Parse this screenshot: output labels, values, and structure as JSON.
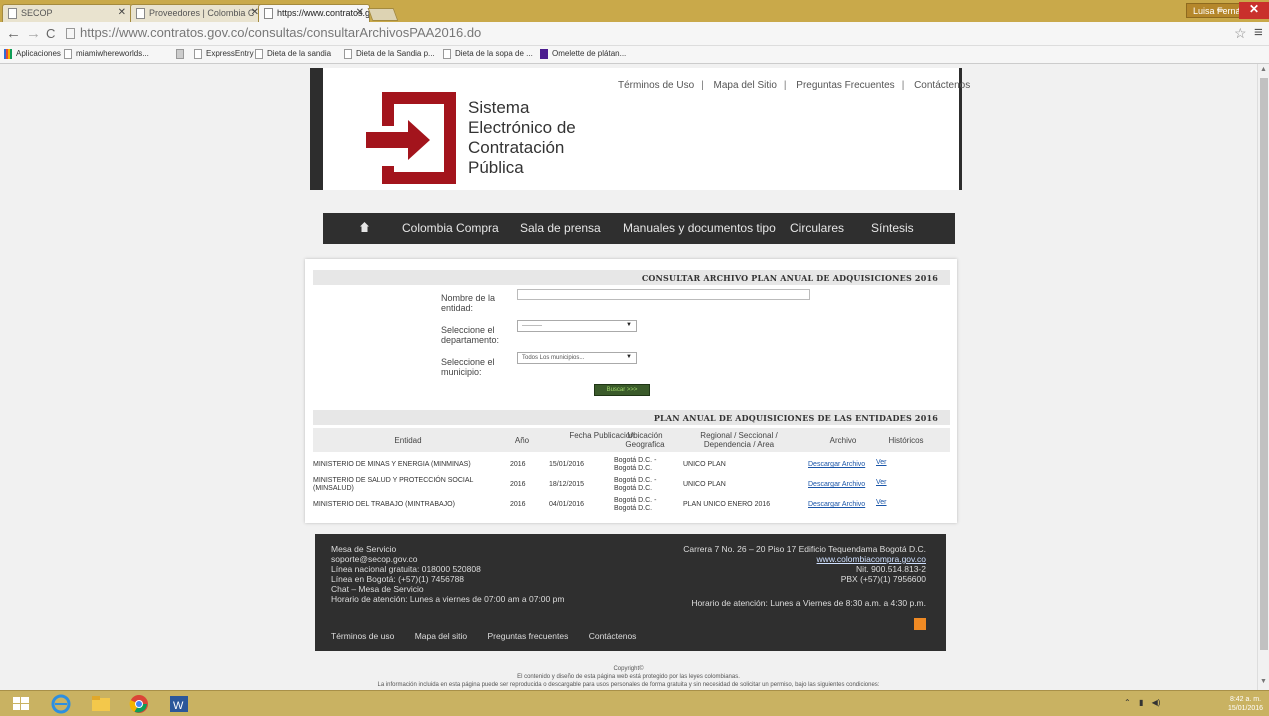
{
  "browser": {
    "tabs": [
      {
        "title": "SECOP"
      },
      {
        "title": "Proveedores | Colombia C"
      },
      {
        "title": "https://www.contratos.go"
      }
    ],
    "user": "Luisa Fernanda",
    "url": "https://www.contratos.gov.co/consultas/consultarArchivosPAA2016.do",
    "bookmarks": [
      "Aplicaciones",
      "miamiwhereworlds...",
      "",
      "ExpressEntry",
      "Dieta de la sandia",
      "Dieta de la Sandia p...",
      "Dieta de la sopa de ...",
      "Omelette de plátan..."
    ]
  },
  "header": {
    "logo_text": [
      "Sistema",
      "Electrónico de",
      "Contratación",
      "Pública"
    ],
    "links": [
      "Términos de Uso",
      "Mapa del Sitio",
      "Preguntas Frecuentes",
      "Contáctenos"
    ]
  },
  "nav": {
    "items": [
      "Colombia Compra",
      "Sala de prensa",
      "Manuales y documentos tipo",
      "Circulares",
      "Síntesis"
    ]
  },
  "form": {
    "section_title": "CONSULTAR ARCHIVO PLAN ANUAL DE ADQUISICIONES 2016",
    "entity_label": "Nombre de la entidad:",
    "entity_value": "",
    "department_label": "Seleccione el departamento:",
    "department_value": "----------",
    "municipality_label": "Seleccione el municipio:",
    "municipality_value": "Todos Los municipios...",
    "search_label": "Buscar >>>"
  },
  "results": {
    "section_title": "PLAN ANUAL DE ADQUISICIONES DE LAS ENTIDADES 2016",
    "columns": [
      "Entidad",
      "Año",
      "Fecha Publicación",
      "Ubicación Geografica",
      "Regional / Seccional / Dependencia / Area",
      "Archivo",
      "Históricos"
    ],
    "rows": [
      {
        "entidad": "MINISTERIO DE MINAS Y ENERGIA (MINMINAS)",
        "anio": "2016",
        "fecha": "15/01/2016",
        "ubicacion": "Bogotá D.C. - Bogotá D.C.",
        "regional": "UNICO PLAN",
        "archivo": "Descargar Archivo",
        "historicos": "Ver"
      },
      {
        "entidad": "MINISTERIO DE SALUD Y PROTECCIÓN SOCIAL (MINSALUD)",
        "anio": "2016",
        "fecha": "18/12/2015",
        "ubicacion": "Bogotá D.C. - Bogotá D.C.",
        "regional": "UNICO PLAN",
        "archivo": "Descargar Archivo",
        "historicos": "Ver"
      },
      {
        "entidad": "MINISTERIO DEL TRABAJO (MINTRABAJO)",
        "anio": "2016",
        "fecha": "04/01/2016",
        "ubicacion": "Bogotá D.C. - Bogotá D.C.",
        "regional": "PLAN UNICO ENERO 2016",
        "archivo": "Descargar Archivo",
        "historicos": "Ver"
      }
    ]
  },
  "footer": {
    "left": [
      "Mesa de Servicio",
      "soporte@secop.gov.co",
      "Línea nacional gratuita: 018000 520808",
      "Línea en Bogotá: (+57)(1) 7456788",
      "Chat – Mesa de Servicio",
      "Horario  de atención: Lunes a viernes de 07:00 am a 07:00 pm"
    ],
    "address": "Carrera 7 No. 26 – 20 Piso 17 Edificio Tequendama Bogotá D.C.",
    "website": "www.colombiacompra.gov.co",
    "nit": "Nit. 900.514.813-2",
    "pbx": "PBX (+57)(1) 7956600",
    "hours": "Horario de atención: Lunes a Viernes de 8:30 a.m. a 4:30 p.m.",
    "links": [
      "Términos de uso",
      "Mapa del sitio",
      "Preguntas frecuentes",
      "Contáctenos"
    ]
  },
  "legal": {
    "copyright": "Copyright©",
    "line1": "El contenido y diseño de esta página web está protegido por las leyes colombianas.",
    "line2": "La información incluida en esta página puede ser reproducida o descargable para usos personales de forma gratuita y sin necesidad de solicitar un permiso, bajo las siguientes condiciones:"
  },
  "taskbar": {
    "clock_time": "8:42 a. m.",
    "clock_date": "15/01/2016"
  },
  "colors": {
    "brand_red": "#a3141c",
    "dark_bar": "#2f2f2f",
    "chrome_gold": "#c9a94a"
  }
}
